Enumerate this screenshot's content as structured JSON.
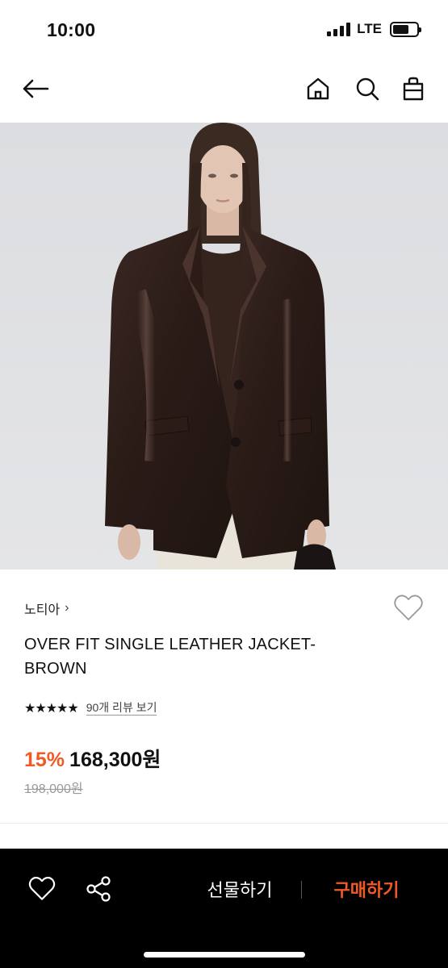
{
  "status_bar": {
    "time": "10:00",
    "network": "LTE"
  },
  "nav": {
    "back_icon": "arrow-left-icon",
    "icons": [
      "home-icon",
      "search-icon",
      "shopping-bag-icon"
    ]
  },
  "product": {
    "brand": "노티아",
    "brand_chevron": "›",
    "title": "OVER FIT SINGLE LEATHER JACKET-BROWN",
    "rating_stars": 5,
    "stars_text": "★★★★★",
    "review_link": "90개 리뷰 보기",
    "discount": "15%",
    "price": "168,300원",
    "original_price": "198,000원"
  },
  "gallery": {
    "active_index": 1,
    "indicator_fraction": 0.25
  },
  "bottom_bar": {
    "gift_label": "선물하기",
    "buy_label": "구매하기"
  },
  "colors": {
    "accent": "#f15a24",
    "bottom_bar_bg": "#000000",
    "text": "#111111"
  }
}
